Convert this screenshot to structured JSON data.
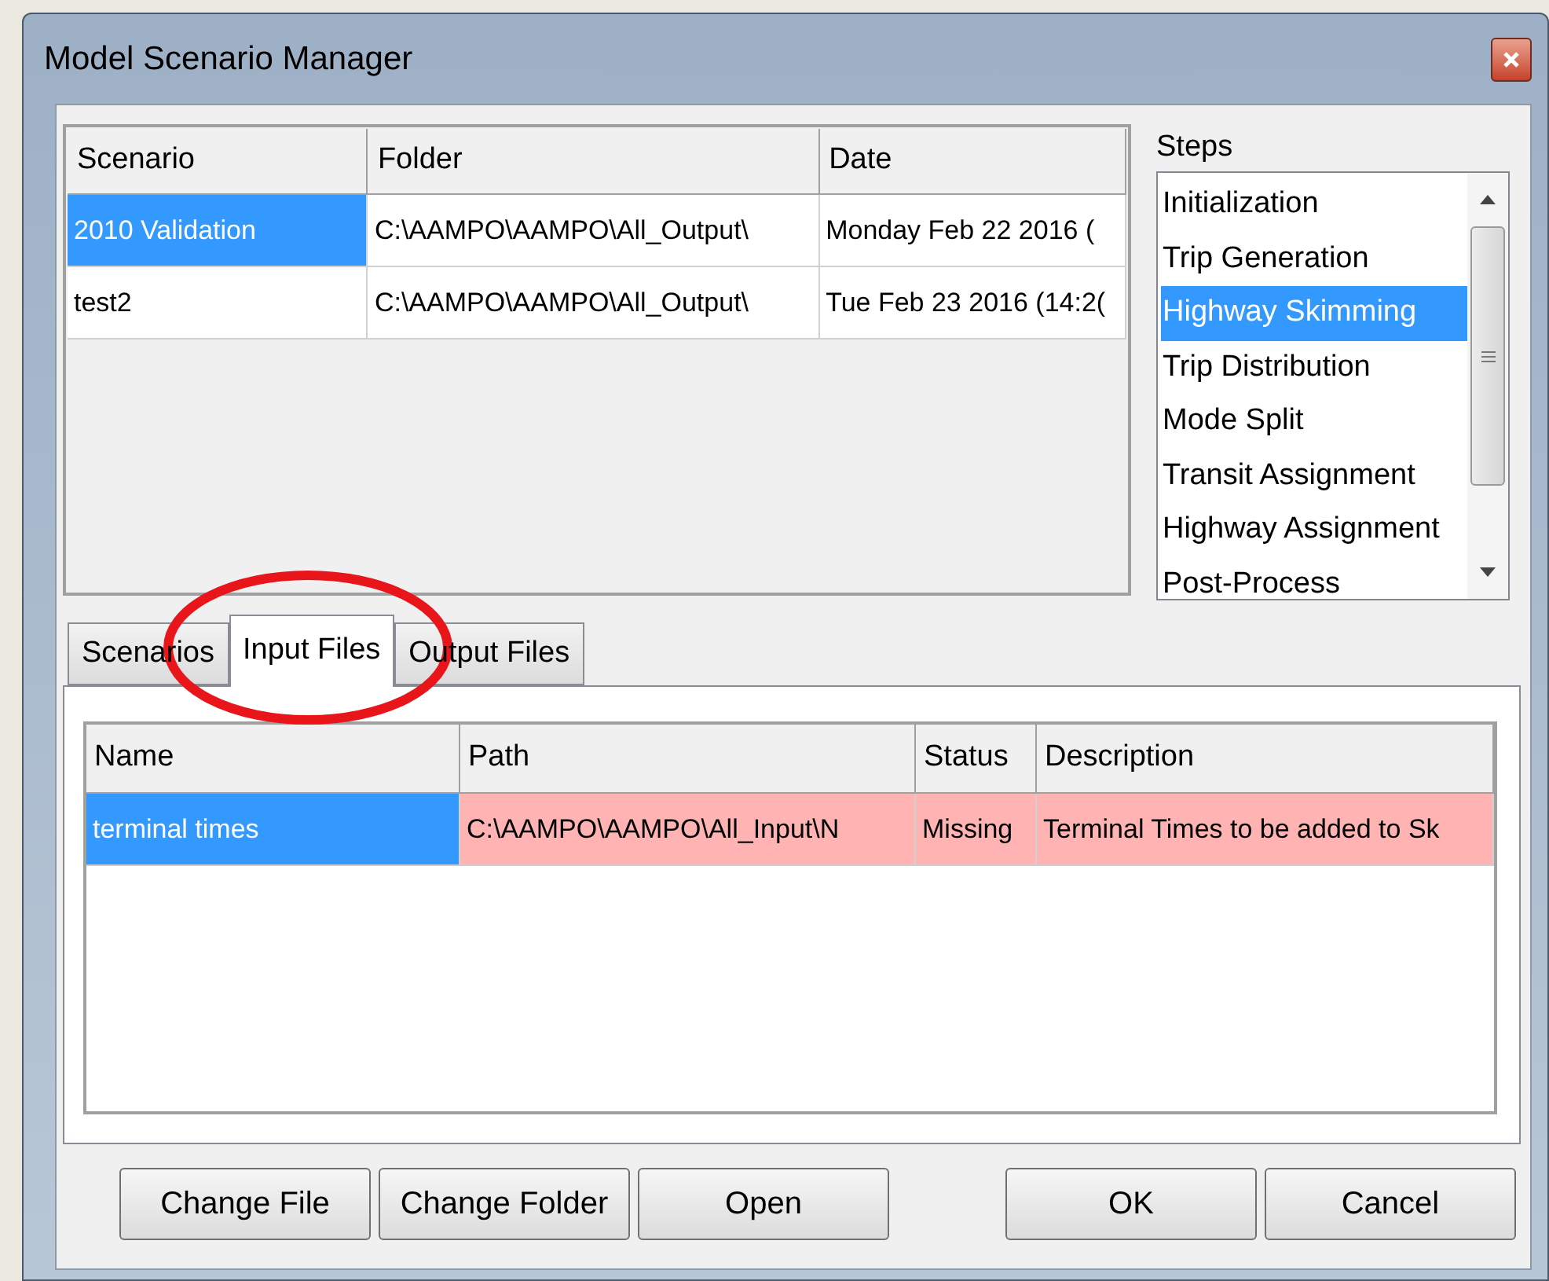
{
  "window": {
    "title": "Model Scenario Manager"
  },
  "scenarios_table": {
    "columns": [
      "Scenario",
      "Folder",
      "Date"
    ],
    "rows": [
      {
        "cells": [
          "2010 Validation",
          "C:\\AAMPO\\AAMPO\\All_Output\\",
          "Monday Feb 22 2016 ("
        ],
        "selected": true
      },
      {
        "cells": [
          "test2",
          "C:\\AAMPO\\AAMPO\\All_Output\\",
          "Tue Feb 23 2016 (14:2("
        ],
        "selected": false
      }
    ]
  },
  "steps": {
    "label": "Steps",
    "items": [
      {
        "label": "Initialization",
        "selected": false
      },
      {
        "label": "Trip Generation",
        "selected": false
      },
      {
        "label": "Highway Skimming",
        "selected": true
      },
      {
        "label": "Trip Distribution",
        "selected": false
      },
      {
        "label": "Mode Split",
        "selected": false
      },
      {
        "label": "Transit Assignment",
        "selected": false
      },
      {
        "label": "Highway Assignment",
        "selected": false
      },
      {
        "label": "Post-Process",
        "selected": false
      }
    ]
  },
  "tabs": [
    {
      "label": "Scenarios",
      "selected": false
    },
    {
      "label": "Input Files",
      "selected": true
    },
    {
      "label": "Output Files",
      "selected": false
    }
  ],
  "files_table": {
    "columns": [
      "Name",
      "Path",
      "Status",
      "Description"
    ],
    "rows": [
      {
        "cells": [
          "terminal times",
          "C:\\AAMPO\\AAMPO\\All_Input\\N",
          "Missing",
          "Terminal Times to be added to Sk"
        ],
        "selected": true,
        "missing": true
      }
    ]
  },
  "buttons_left": [
    "Change File",
    "Change Folder",
    "Open"
  ],
  "buttons_right": [
    "OK",
    "Cancel"
  ],
  "annotation": {
    "kind": "ellipse",
    "color": "#e8151b"
  }
}
